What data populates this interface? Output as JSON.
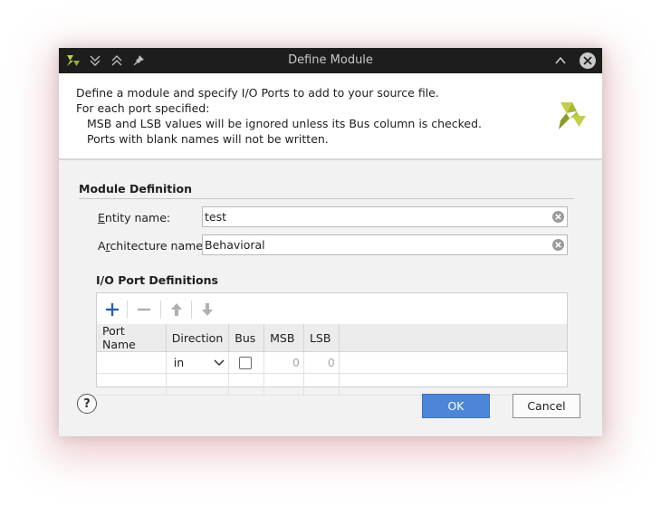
{
  "window": {
    "title": "Define Module",
    "left_icons": [
      "xilinx-logo-icon",
      "double-chevron-down-icon",
      "double-chevron-up-icon",
      "pin-icon"
    ],
    "right_icons": [
      "chevron-up-icon",
      "close-icon"
    ]
  },
  "banner": {
    "line1": "Define a module and specify I/O Ports to add to your source file.",
    "line2": "For each port specified:",
    "line3": "MSB and LSB values will be ignored unless its Bus column is checked.",
    "line4": "Ports with blank names will not be written.",
    "logo_icon": "xilinx-logo-icon"
  },
  "module_definition": {
    "title": "Module Definition",
    "entity": {
      "label_mnemonic": "E",
      "label_rest": "ntity name:",
      "value": "test"
    },
    "architecture": {
      "label_pre": "A",
      "label_mnemonic": "r",
      "label_rest": "chitecture name:",
      "value": "Behavioral"
    }
  },
  "io_ports": {
    "title": "I/O Port Definitions",
    "toolbar": [
      "add-icon",
      "remove-icon",
      "move-up-icon",
      "move-down-icon"
    ],
    "columns": [
      "Port Name",
      "Direction",
      "Bus",
      "MSB",
      "LSB"
    ],
    "rows": [
      {
        "port_name": "",
        "direction": "in",
        "bus": false,
        "msb": "0",
        "lsb": "0"
      }
    ]
  },
  "footer": {
    "help_label": "?",
    "ok_label": "OK",
    "cancel_label": "Cancel"
  },
  "colors": {
    "titlebar": "#1d1d1d",
    "ok_button": "#4d86d8",
    "logo_light": "#c3cf4b",
    "logo_dark": "#8a9b2a"
  }
}
